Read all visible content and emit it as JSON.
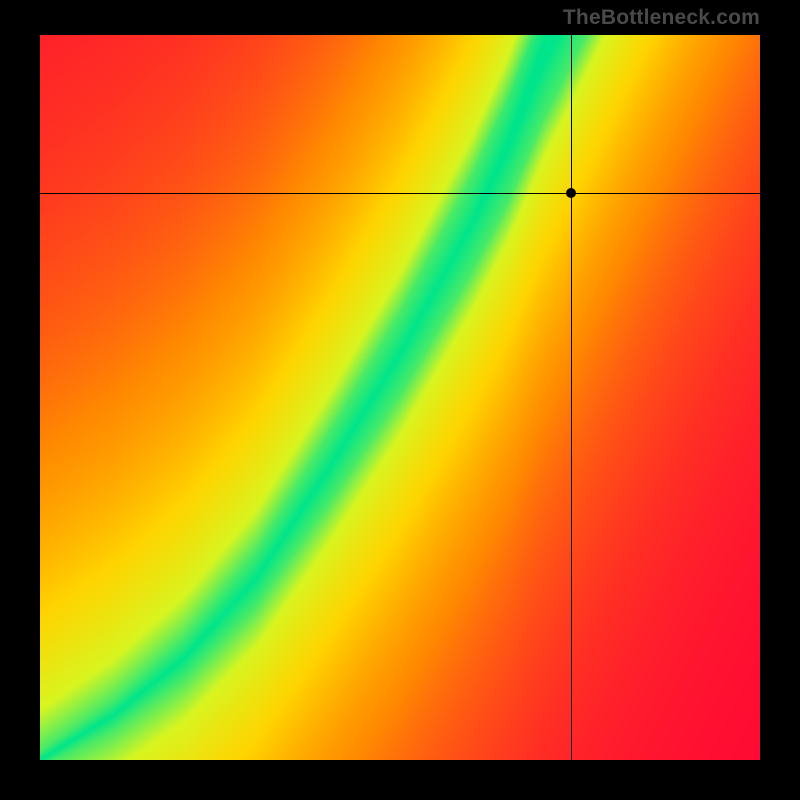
{
  "watermark": "TheBottleneck.com",
  "chart_data": {
    "type": "heatmap",
    "title": "",
    "xlabel": "",
    "ylabel": "",
    "xlim": [
      0,
      1
    ],
    "ylim": [
      0,
      1
    ],
    "crosshair": {
      "x": 0.737,
      "y": 0.782
    },
    "optimal_curve_points": [
      {
        "x": 0.0,
        "y": 0.0
      },
      {
        "x": 0.1,
        "y": 0.06
      },
      {
        "x": 0.2,
        "y": 0.14
      },
      {
        "x": 0.3,
        "y": 0.25
      },
      {
        "x": 0.4,
        "y": 0.4
      },
      {
        "x": 0.5,
        "y": 0.56
      },
      {
        "x": 0.55,
        "y": 0.65
      },
      {
        "x": 0.6,
        "y": 0.74
      },
      {
        "x": 0.65,
        "y": 0.84
      },
      {
        "x": 0.7,
        "y": 0.96
      },
      {
        "x": 0.72,
        "y": 1.0
      }
    ],
    "color_scale": [
      {
        "t": 0.0,
        "color": "#00e58b"
      },
      {
        "t": 0.18,
        "color": "#d8f520"
      },
      {
        "t": 0.4,
        "color": "#ffd400"
      },
      {
        "t": 0.65,
        "color": "#ff8a00"
      },
      {
        "t": 0.85,
        "color": "#ff3a1f"
      },
      {
        "t": 1.0,
        "color": "#ff0038"
      }
    ],
    "band_halfwidth_start": 0.012,
    "band_halfwidth_end": 0.075,
    "gradient_softness": 2.4
  }
}
